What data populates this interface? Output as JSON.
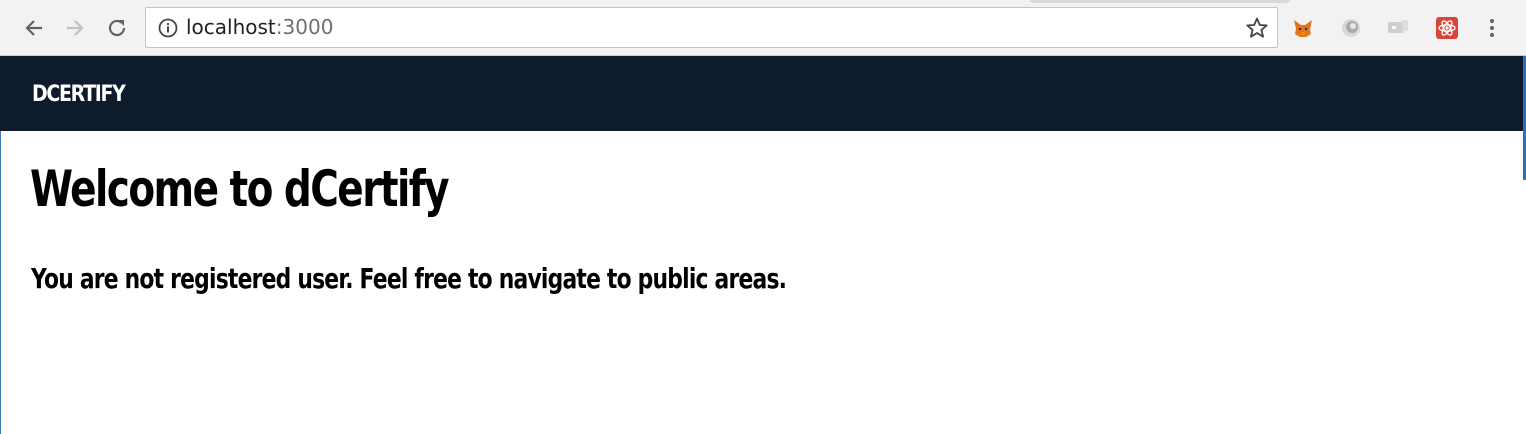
{
  "browser": {
    "url_host": "localhost",
    "url_port": ":3000"
  },
  "navbar": {
    "brand": "DCERTIFY"
  },
  "main": {
    "title": "Welcome to dCertify",
    "subtitle": "You are not registered user. Feel free to navigate to public areas."
  },
  "colors": {
    "navbar_bg": "#0e1b2d",
    "toolbar_bg": "#f2f2f2"
  },
  "extensions": [
    "metamask-icon",
    "circle-extension-icon",
    "cast-extension-icon",
    "react-devtools-icon"
  ]
}
